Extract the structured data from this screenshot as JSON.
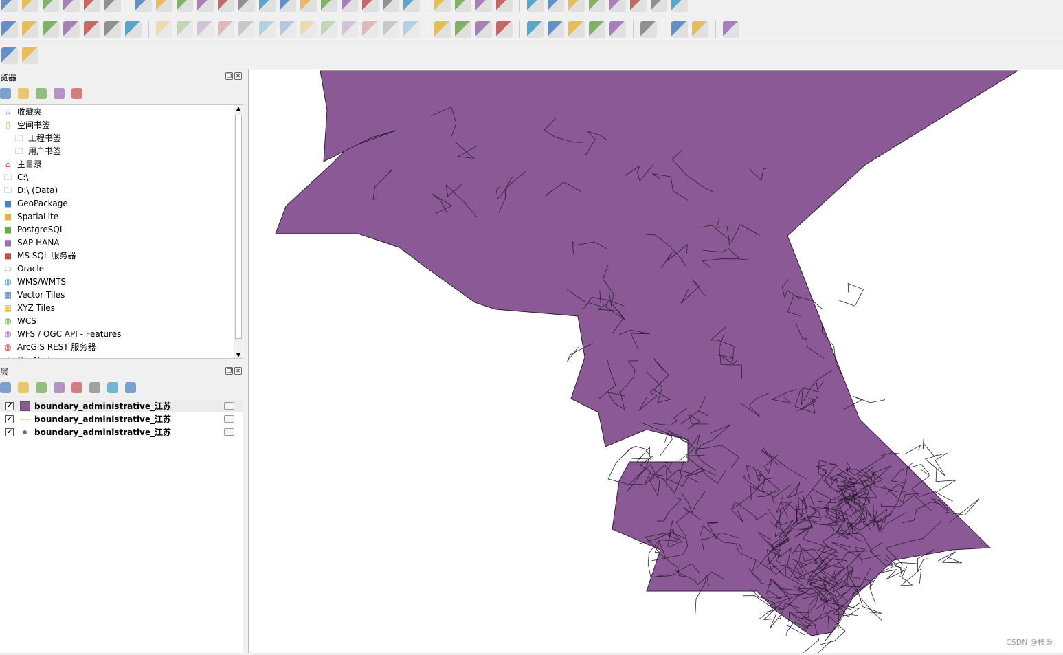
{
  "toolbars": {
    "row1": [
      "new-project-icon",
      "open-project-icon",
      "save-project-icon",
      "new-print-layout-icon",
      "layout-manager-icon",
      "style-manager-icon",
      "|",
      "pan-icon",
      "pan-to-selection-icon",
      "zoom-in-icon",
      "zoom-out-icon",
      "zoom-full-icon",
      "zoom-selection-icon",
      "zoom-layer-icon",
      "zoom-native-icon",
      "zoom-last-icon",
      "zoom-next-icon",
      "new-map-view-icon",
      "new-3d-view-icon",
      "temporal-icon",
      "refresh-icon",
      "|",
      "select-feature-icon",
      "select-value-icon",
      "deselect-icon",
      "identify-icon",
      "|",
      "measure-icon",
      "attribute-table-icon",
      "processing-icon",
      "statistics-icon",
      "field-calc-icon",
      "ruler-icon",
      "tips-icon",
      "locate-icon"
    ],
    "row2": [
      "add-vector-icon",
      "add-geopackage-icon",
      "add-vector-layer-icon",
      "add-spatialite-icon",
      "add-mesh-icon",
      "add-wms-icon",
      "add-virtual-icon",
      "|",
      "edit-icon",
      "toggle-edit-icon",
      "save-edits-icon",
      "digitize-icon",
      "add-polygon-icon",
      "vertex-tool-icon",
      "modify-attributes-icon",
      "delete-icon",
      "cut-icon",
      "copy-icon",
      "paste-icon",
      "undo-icon",
      "redo-icon",
      "|",
      "label-icon",
      "diagram-icon",
      "pin-label-icon",
      "highlight-label-icon",
      "|",
      "show-label-icon",
      "hide-label-icon",
      "move-label-icon",
      "rotate-label-icon",
      "change-label-icon",
      "|",
      "georeferencer-icon",
      "|",
      "python-icon",
      "expression-icon",
      "|",
      "help-icon"
    ],
    "row3": [
      "locator-icon",
      "plugin-icon"
    ]
  },
  "browser": {
    "title": "览器",
    "tools": [
      "add-icon",
      "refresh-icon",
      "filter-icon",
      "collapse-icon",
      "info-icon"
    ],
    "items": [
      {
        "label": "收藏夹",
        "icon": "star-icon",
        "indent": 0
      },
      {
        "label": "空间书签",
        "icon": "bookmark-icon",
        "indent": 0
      },
      {
        "label": "工程书签",
        "icon": "folder-icon",
        "indent": 1
      },
      {
        "label": "用户书签",
        "icon": "folder-icon",
        "indent": 1
      },
      {
        "label": "主目录",
        "icon": "home-icon",
        "indent": 0
      },
      {
        "label": "C:\\",
        "icon": "folder-icon",
        "indent": 0
      },
      {
        "label": "D:\\ (Data)",
        "icon": "folder-icon",
        "indent": 0
      },
      {
        "label": "GeoPackage",
        "icon": "geopackage-icon",
        "indent": 0
      },
      {
        "label": "SpatiaLite",
        "icon": "spatialite-icon",
        "indent": 0
      },
      {
        "label": "PostgreSQL",
        "icon": "postgresql-icon",
        "indent": 0
      },
      {
        "label": "SAP HANA",
        "icon": "hana-icon",
        "indent": 0
      },
      {
        "label": "MS SQL 服务器",
        "icon": "mssql-icon",
        "indent": 0
      },
      {
        "label": "Oracle",
        "icon": "oracle-icon",
        "indent": 0
      },
      {
        "label": "WMS/WMTS",
        "icon": "globe-icon",
        "indent": 0
      },
      {
        "label": "Vector Tiles",
        "icon": "grid-icon",
        "indent": 0
      },
      {
        "label": "XYZ Tiles",
        "icon": "grid-icon",
        "indent": 0
      },
      {
        "label": "WCS",
        "icon": "globe-icon",
        "indent": 0
      },
      {
        "label": "WFS / OGC API - Features",
        "icon": "globe-icon",
        "indent": 0
      },
      {
        "label": "ArcGIS REST 服务器",
        "icon": "globe-icon",
        "indent": 0
      },
      {
        "label": "GeoNode",
        "icon": "geonode-icon",
        "indent": 0
      }
    ]
  },
  "layers": {
    "title": "层",
    "tools": [
      "style-icon",
      "add-group-icon",
      "visibility-icon",
      "filter-icon",
      "expression-filter-icon",
      "expand-icon",
      "collapse-icon",
      "remove-layer-icon"
    ],
    "items": [
      {
        "name": "boundary_administrative_江苏",
        "type": "polygon",
        "checked": true,
        "selected": true
      },
      {
        "name": "boundary_administrative_江苏",
        "type": "line",
        "checked": true,
        "selected": false
      },
      {
        "name": "boundary_administrative_江苏",
        "type": "point",
        "checked": true,
        "selected": false
      }
    ]
  },
  "colors": {
    "fill": "#8b5a96",
    "line": "#d9e0b0",
    "outline": "#2e1f33"
  },
  "watermark": "CSDN @枝枭"
}
